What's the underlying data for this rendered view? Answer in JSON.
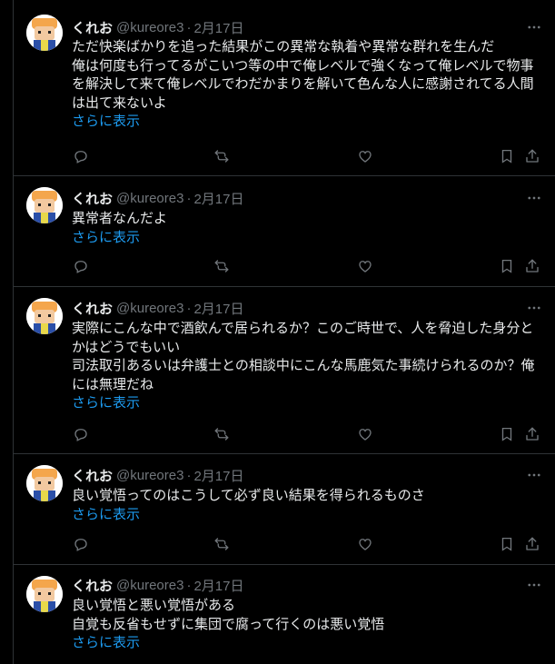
{
  "user": {
    "display_name": "くれお",
    "handle": "@kureore3",
    "separator": "·"
  },
  "show_more_label": "さらに表示",
  "tweets": [
    {
      "date": "2月17日",
      "lines": [
        "ただ快楽ばかりを追った結果がこの異常な執着や異常な群れを生んだ",
        "俺は何度も行ってるがこいつ等の中で俺レベルで強くなって俺レベルで物事",
        "を解決して来て俺レベルでわだかまりを解いて色んな人に感謝されてる人間",
        "は出て来ないよ"
      ]
    },
    {
      "date": "2月17日",
      "lines": [
        "異常者なんだよ"
      ]
    },
    {
      "date": "2月17日",
      "lines": [
        "実際にこんな中で酒飲んで居られるか？このご時世で、人を脅迫した身分と",
        "かはどうでもいい",
        "司法取引あるいは弁護士との相談中にこんな馬鹿気た事続けられるのか？俺",
        "には無理だね"
      ]
    },
    {
      "date": "2月17日",
      "lines": [
        "良い覚悟ってのはこうして必ず良い結果を得られるものさ"
      ]
    },
    {
      "date": "2月17日",
      "lines": [
        "良い覚悟と悪い覚悟がある",
        "自覚も反省もせずに集団で腐って行くのは悪い覚悟"
      ]
    }
  ]
}
